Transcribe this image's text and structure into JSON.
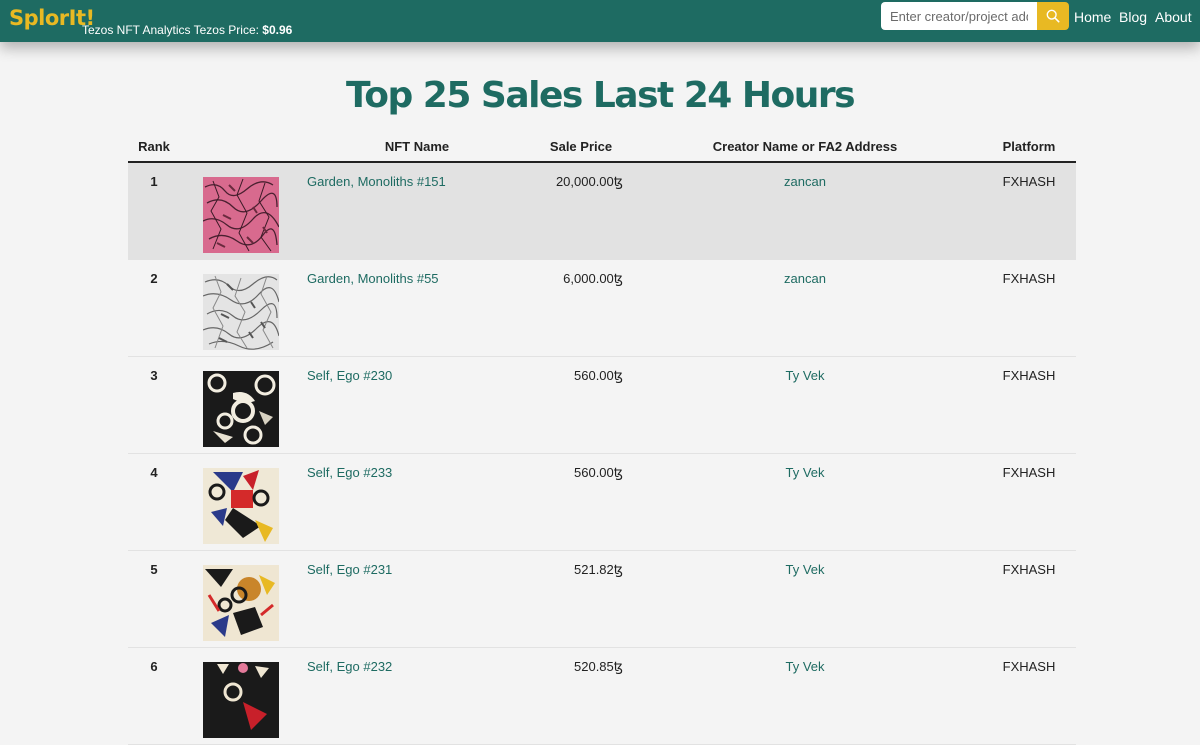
{
  "header": {
    "brand": "SplorIt!",
    "tagline": "Tezos NFT Analytics Tezos Price: ",
    "price": "$0.96",
    "search_placeholder": "Enter creator/project address",
    "nav": [
      "Home",
      "Blog",
      "About"
    ]
  },
  "colors": {
    "accent": "#1e6b62",
    "brand": "#e8b923",
    "highlight_row": "#e2e2e2"
  },
  "page": {
    "title": "Top 25 Sales Last 24 Hours"
  },
  "table": {
    "columns": [
      "Rank",
      "",
      "NFT Name",
      "Sale Price",
      "Creator Name or FA2 Address",
      "Platform"
    ],
    "rows": [
      {
        "rank": "1",
        "name": "Garden, Monoliths #151",
        "price": "20,000.00ꜩ",
        "creator": "zancan",
        "platform": "FXHASH",
        "thumb": "pink-garden"
      },
      {
        "rank": "2",
        "name": "Garden, Monoliths #55",
        "price": "6,000.00ꜩ",
        "creator": "zancan",
        "platform": "FXHASH",
        "thumb": "grey-garden"
      },
      {
        "rank": "3",
        "name": "Self, Ego #230",
        "price": "560.00ꜩ",
        "creator": "Ty Vek",
        "platform": "FXHASH",
        "thumb": "black-circles"
      },
      {
        "rank": "4",
        "name": "Self, Ego #233",
        "price": "560.00ꜩ",
        "creator": "Ty Vek",
        "platform": "FXHASH",
        "thumb": "red-blue-collage"
      },
      {
        "rank": "5",
        "name": "Self, Ego #231",
        "price": "521.82ꜩ",
        "creator": "Ty Vek",
        "platform": "FXHASH",
        "thumb": "orange-collage"
      },
      {
        "rank": "6",
        "name": "Self, Ego #232",
        "price": "520.85ꜩ",
        "creator": "Ty Vek",
        "platform": "FXHASH",
        "thumb": "dark-collage"
      }
    ]
  }
}
